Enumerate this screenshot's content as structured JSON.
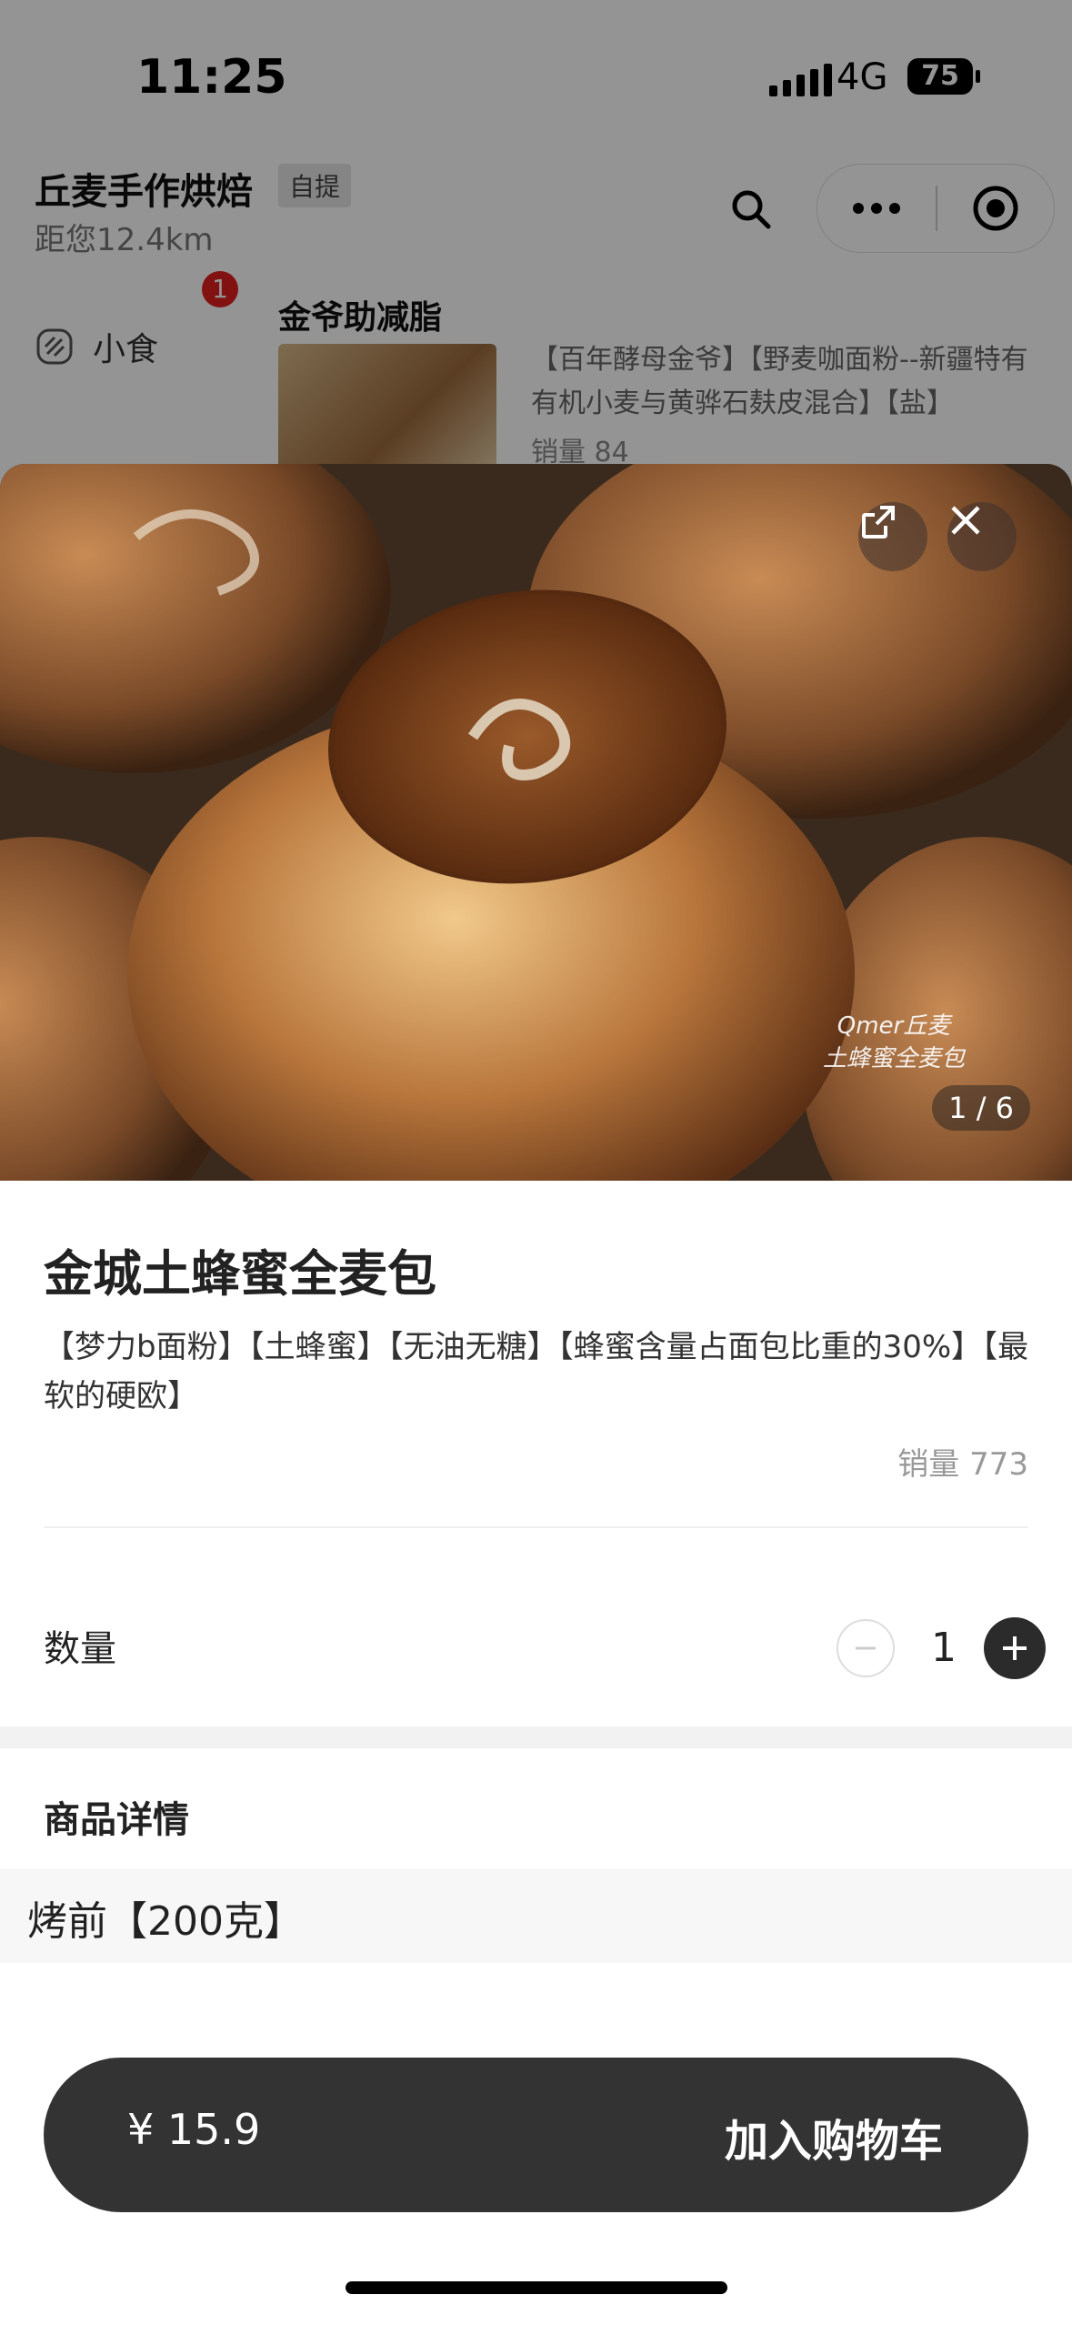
{
  "status_bar": {
    "time": "11:25",
    "network": "4G",
    "battery": "75"
  },
  "shop": {
    "name": "丘麦手作烘焙",
    "pickup_tag": "自提",
    "distance": "距您12.4km"
  },
  "category": {
    "label": "小食",
    "badge": "1"
  },
  "background_item": {
    "section_title": "金爷助减脂",
    "description": "【百年酵母金爷】【野麦咖面粉--新疆特有有机小麦与黄骅石麸皮混合】【盐】",
    "sales": "销量 84"
  },
  "product": {
    "image_counter": "1 / 6",
    "watermark_line1": "Qmer丘麦",
    "watermark_line2": "土蜂蜜全麦包",
    "title": "金城土蜂蜜全麦包",
    "description": "【梦力b面粉】【土蜂蜜】【无油无糖】【蜂蜜含量占面包比重的30%】【最软的硬欧】",
    "sales": "销量 773"
  },
  "quantity": {
    "label": "数量",
    "value": "1"
  },
  "details": {
    "title": "商品详情",
    "text": "烤前【200克】"
  },
  "cart": {
    "price": "¥ 15.9",
    "button_label": "加入购物车"
  },
  "icons": [
    "search-icon",
    "more-icon",
    "target-icon",
    "share-icon",
    "close-icon",
    "minus-icon",
    "plus-icon",
    "bread-icon"
  ]
}
